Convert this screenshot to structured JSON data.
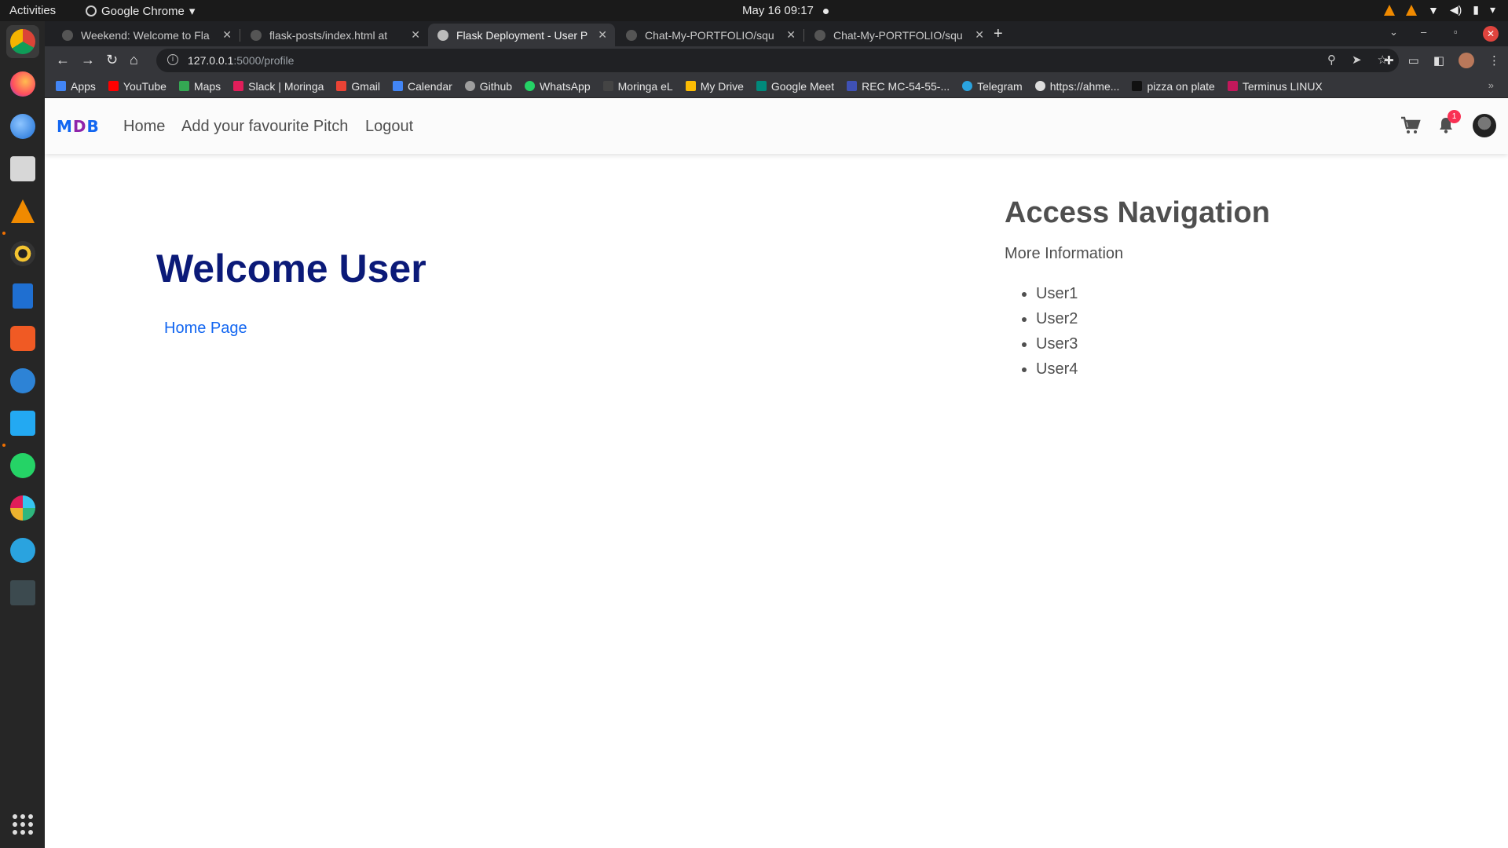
{
  "os_topbar": {
    "activities": "Activities",
    "app_name": "Google Chrome",
    "clock": "May 16  09:17"
  },
  "browser": {
    "tabs": [
      {
        "title": "Weekend: Welcome to Fla"
      },
      {
        "title": "flask-posts/index.html at"
      },
      {
        "title": "Flask Deployment - User P"
      },
      {
        "title": "Chat-My-PORTFOLIO/squ"
      },
      {
        "title": "Chat-My-PORTFOLIO/squ"
      }
    ],
    "url_host": "127.0.0.1",
    "url_path": ":5000/profile",
    "bookmarks": [
      {
        "label": "Apps",
        "color": "#4285f4"
      },
      {
        "label": "YouTube",
        "color": "#ff0000"
      },
      {
        "label": "Maps",
        "color": "#34a853"
      },
      {
        "label": "Slack | Moringa",
        "color": "#e01e5a"
      },
      {
        "label": "Gmail",
        "color": "#ea4335"
      },
      {
        "label": "Calendar",
        "color": "#4285f4"
      },
      {
        "label": "Github",
        "color": "#9e9e9e"
      },
      {
        "label": "WhatsApp",
        "color": "#25d366"
      },
      {
        "label": "Moringa eL",
        "color": "#444444"
      },
      {
        "label": "My Drive",
        "color": "#fbbc04"
      },
      {
        "label": "Google Meet",
        "color": "#00897b"
      },
      {
        "label": "REC MC-54-55-...",
        "color": "#3f51b5"
      },
      {
        "label": "Telegram",
        "color": "#2aa3df"
      },
      {
        "label": "https://ahme...",
        "color": "#dddddd"
      },
      {
        "label": "pizza on plate",
        "color": "#111111"
      },
      {
        "label": "Terminus LINUX",
        "color": "#c2185b"
      }
    ]
  },
  "site": {
    "brand": {
      "m": "M",
      "d": "D",
      "b": "B"
    },
    "nav": {
      "home": "Home",
      "add_pitch": "Add your favourite Pitch",
      "logout": "Logout"
    },
    "notification_count": "1",
    "main": {
      "heading": "Welcome User",
      "home_link": "Home Page"
    },
    "aside": {
      "heading": "Access Navigation",
      "subheading": "More Information",
      "users": [
        "User1",
        "User2",
        "User3",
        "User4"
      ]
    }
  }
}
